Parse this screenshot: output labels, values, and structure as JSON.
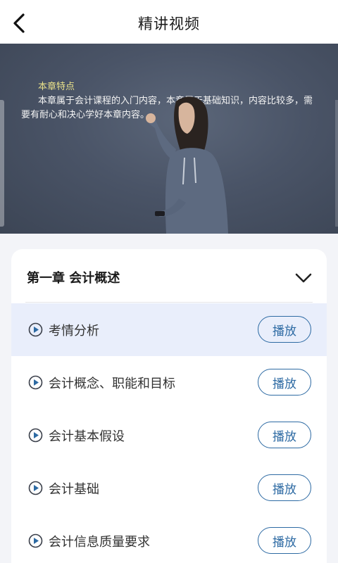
{
  "header": {
    "title": "精讲视频"
  },
  "video": {
    "heading": "本章特点",
    "paragraph": "本章属于会计课程的入门内容，本章属于基础知识，内容比较多，需要有耐心和决心学好本章内容。"
  },
  "chapter": {
    "title": "第一章 会计概述"
  },
  "lessons": [
    {
      "label": "考情分析",
      "button": "播放"
    },
    {
      "label": "会计概念、职能和目标",
      "button": "播放"
    },
    {
      "label": "会计基本假设",
      "button": "播放"
    },
    {
      "label": "会计基础",
      "button": "播放"
    },
    {
      "label": "会计信息质量要求",
      "button": "播放"
    }
  ],
  "colors": {
    "accent": "#2d6aa3",
    "active_row": "#e9eefb",
    "page_bg": "#f3f4f8"
  }
}
